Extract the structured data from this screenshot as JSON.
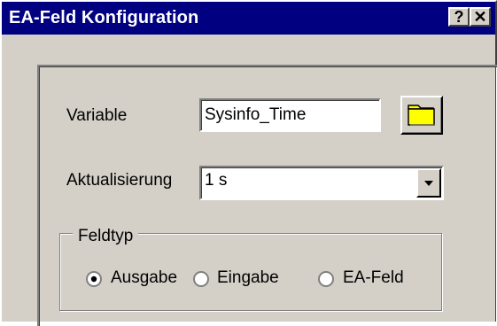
{
  "window": {
    "title": "EA-Feld Konfiguration",
    "help_button": "?",
    "close_button": "✕"
  },
  "form": {
    "variable_label": "Variable",
    "variable_value": "Sysinfo_Time",
    "update_label": "Aktualisierung",
    "update_value": "1 s",
    "fieldtype_legend": "Feldtyp",
    "options": [
      "Ausgabe",
      "Eingabe",
      "EA-Feld"
    ],
    "selected_option": "Ausgabe"
  },
  "colors": {
    "titlebar": "#000080",
    "dialog_face": "#d4d0c8",
    "folder_icon": "#ffff00"
  },
  "icons": {
    "browse": "folder-icon",
    "dropdown": "dropdown-arrow-icon"
  }
}
